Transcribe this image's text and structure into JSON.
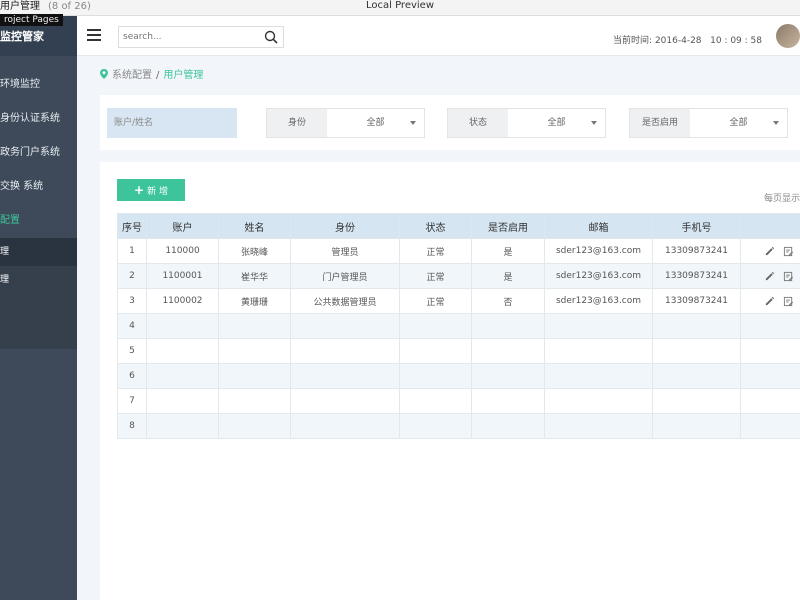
{
  "window": {
    "title": "用户管理",
    "count": "(8 of 26)",
    "preview": "Local Preview",
    "tooltip": "roject Pages"
  },
  "sidebar": {
    "brand": "监控管家",
    "items": [
      {
        "label": "环境监控"
      },
      {
        "label": "身份认证系统"
      },
      {
        "label": "政务门户系统"
      },
      {
        "label": "交换 系统"
      },
      {
        "label": "配置"
      }
    ],
    "subitems": [
      {
        "label": "理"
      },
      {
        "label": "理"
      }
    ]
  },
  "header": {
    "search_placeholder": "search...",
    "time_label": "当前时间:",
    "date": "2016-4-28",
    "clock": "10 : 09 : 58"
  },
  "breadcrumb": {
    "root": "系统配置",
    "sep": "/",
    "current": "用户管理"
  },
  "filters": {
    "account_placeholder": "账户/姓名",
    "groups": [
      {
        "label": "身份",
        "value": "全部"
      },
      {
        "label": "状态",
        "value": "全部"
      },
      {
        "label": "是否启用",
        "value": "全部"
      }
    ]
  },
  "toolbar": {
    "add_label": "新 增",
    "per_page": "每页显示"
  },
  "table": {
    "headers": [
      "序号",
      "账户",
      "姓名",
      "身份",
      "状态",
      "是否启用",
      "邮箱",
      "手机号",
      ""
    ],
    "rows": [
      [
        "1",
        "110000",
        "张晓峰",
        "管理员",
        "正常",
        "是",
        "sder123@163.com",
        "13309873241"
      ],
      [
        "2",
        "1100001",
        "崔华华",
        "门户管理员",
        "正常",
        "是",
        "sder123@163.com",
        "13309873241"
      ],
      [
        "3",
        "1100002",
        "黄珊珊",
        "公共数据管理员",
        "正常",
        "否",
        "sder123@163.com",
        "13309873241"
      ],
      [
        "4",
        "",
        "",
        "",
        "",
        "",
        "",
        ""
      ],
      [
        "5",
        "",
        "",
        "",
        "",
        "",
        "",
        ""
      ],
      [
        "6",
        "",
        "",
        "",
        "",
        "",
        "",
        ""
      ],
      [
        "7",
        "",
        "",
        "",
        "",
        "",
        "",
        ""
      ],
      [
        "8",
        "",
        "",
        "",
        "",
        "",
        "",
        ""
      ]
    ]
  },
  "icons": {
    "edit": "pencil-icon",
    "detail": "doc-edit-icon",
    "search": "search-icon",
    "location": "map-pin-icon"
  },
  "colors": {
    "accent": "#3dc49b",
    "sidebar": "#3e4a59",
    "table_header": "#d5e5f1"
  }
}
